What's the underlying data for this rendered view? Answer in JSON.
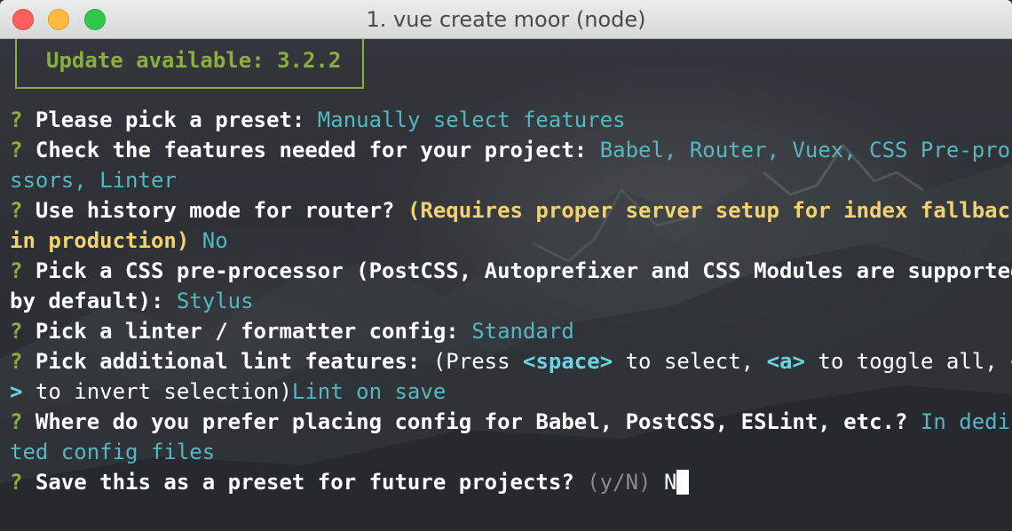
{
  "window": {
    "title": "1. vue create moor (node)"
  },
  "update_notice": "Update available: 3.2.2",
  "prompt_mark": "?",
  "lines": {
    "preset_q": "Please pick a preset:",
    "preset_a": "Manually select features",
    "features_q": "Check the features needed for your project:",
    "features_a1": "Babel, Router, Vuex, CSS Pre-proce",
    "features_a2": "ssors, Linter",
    "history_q": "Use history mode for router?",
    "history_note1": "(Requires proper server setup for index fallback",
    "history_note2": "in production)",
    "history_a": "No",
    "css_q1": "Pick a CSS pre-processor (PostCSS, Autoprefixer and CSS Modules are supported",
    "css_q2": "by default):",
    "css_a": "Stylus",
    "linter_q": "Pick a linter / formatter config:",
    "linter_a": "Standard",
    "lintfeat_q": "Pick additional lint features:",
    "lintfeat_press": "(Press",
    "lintfeat_space": "<space>",
    "lintfeat_select": "to select,",
    "lintfeat_a_key": "<a>",
    "lintfeat_toggle": "to toggle all,",
    "lintfeat_i_key1": "<i",
    "lintfeat_i_key2": ">",
    "lintfeat_invert": "to invert selection)",
    "lintfeat_a": "Lint on save",
    "config_q": "Where do you prefer placing config for Babel, PostCSS, ESLint, etc.?",
    "config_a1": "In dedica",
    "config_a2": "ted config files",
    "save_q": "Save this as a preset for future projects?",
    "save_hint": "(y/N)",
    "save_input": "N"
  },
  "colors": {
    "prompt_green": "#8cae3f",
    "answer_cyan": "#56b6c2",
    "note_yellow": "#f2d370",
    "key_cyan": "#6ad4e0",
    "hint_gray": "#8a8a8a"
  }
}
